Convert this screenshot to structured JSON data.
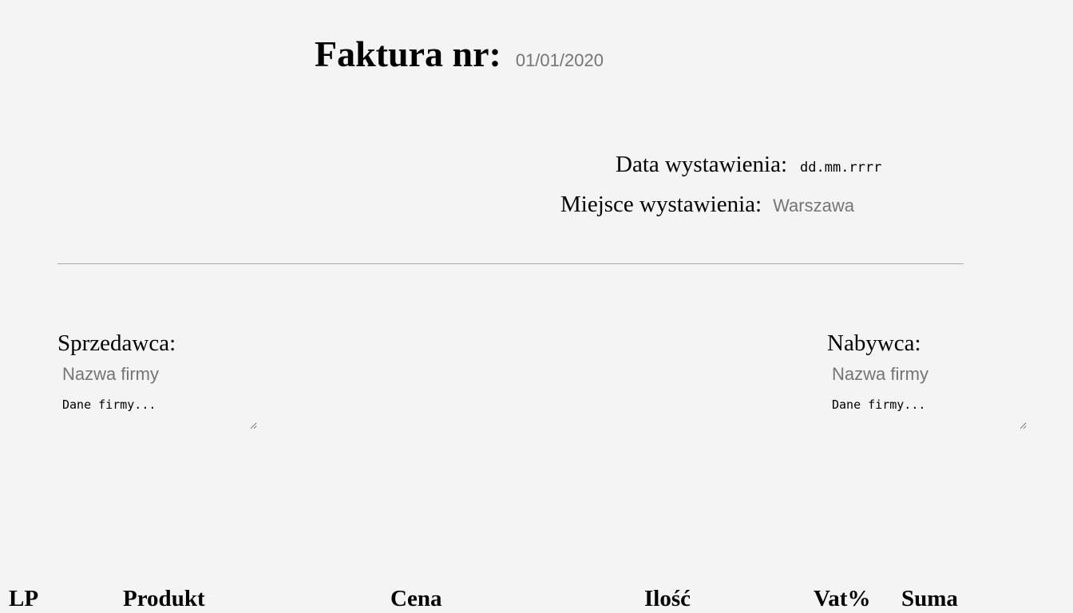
{
  "header": {
    "title": "Faktura nr:",
    "invoice_number_placeholder": "01/01/2020"
  },
  "meta": {
    "date_label": "Data wystawienia:",
    "date_placeholder": "dd.mm.rrrr",
    "place_label": "Miejsce wystawienia:",
    "place_placeholder": "Warszawa"
  },
  "seller": {
    "label": "Sprzedawca:",
    "name_placeholder": "Nazwa firmy",
    "details_placeholder": "Dane firmy..."
  },
  "buyer": {
    "label": "Nabywca:",
    "name_placeholder": "Nazwa firmy",
    "details_placeholder": "Dane firmy..."
  },
  "table": {
    "columns": [
      "LP",
      "Produkt",
      "Cena",
      "Ilość",
      "Vat%",
      "Suma"
    ]
  }
}
